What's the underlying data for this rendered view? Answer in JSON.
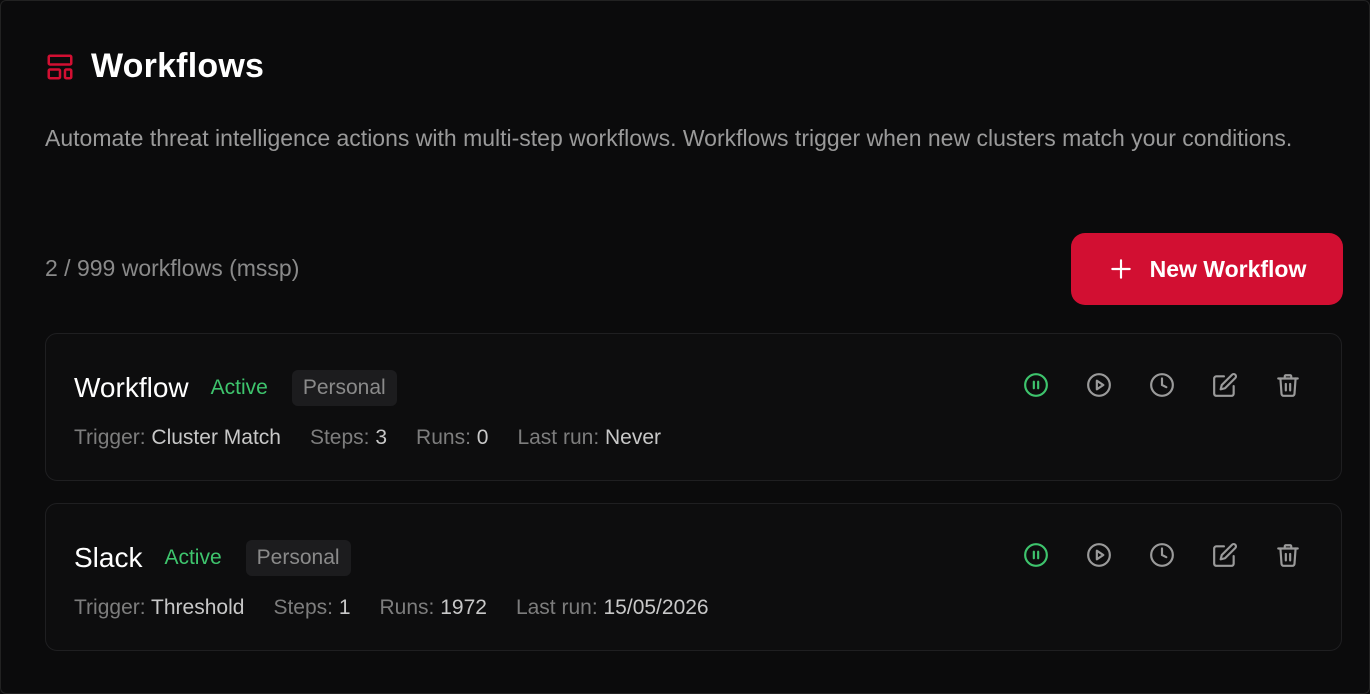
{
  "page": {
    "title": "Workflows",
    "description": "Automate threat intelligence actions with multi-step workflows. Workflows trigger when new clusters match your conditions.",
    "count_text": "2 / 999 workflows (mssp)",
    "new_button_label": "New Workflow",
    "accent_color": "#d20f32",
    "active_color": "#3ec46d"
  },
  "labels": {
    "trigger": "Trigger:",
    "steps": "Steps:",
    "runs": "Runs:",
    "last_run": "Last run:"
  },
  "workflows": [
    {
      "name": "Workflow",
      "status": "Active",
      "scope": "Personal",
      "trigger": "Cluster Match",
      "steps": "3",
      "runs": "0",
      "last_run": "Never"
    },
    {
      "name": "Slack",
      "status": "Active",
      "scope": "Personal",
      "trigger": "Threshold",
      "steps": "1",
      "runs": "1972",
      "last_run": "15/05/2026"
    }
  ],
  "icons": {
    "header": "layout-template-icon",
    "new": "plus-icon",
    "pause": "pause-circle-icon",
    "run": "play-circle-icon",
    "history": "clock-icon",
    "edit": "edit-icon",
    "delete": "trash-icon"
  }
}
